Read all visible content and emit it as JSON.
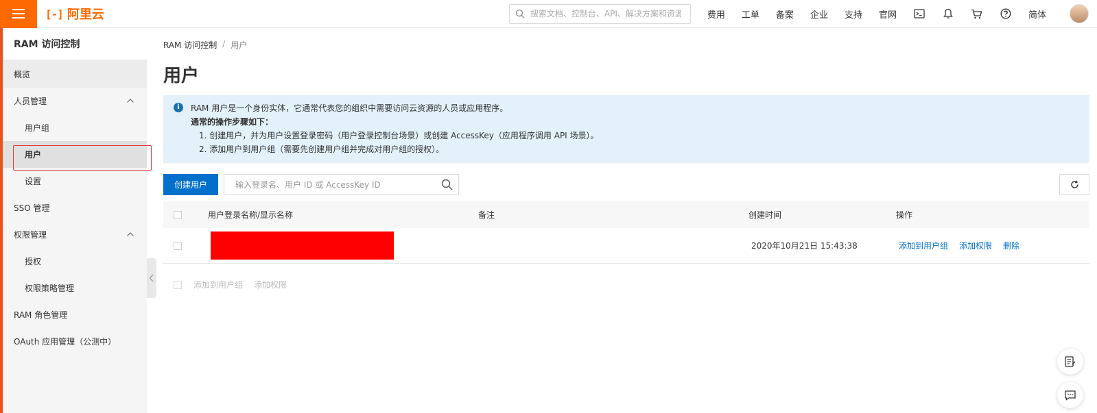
{
  "topbar": {
    "logo_text": "阿里云",
    "logo_mark": "[-]",
    "search_placeholder": "搜索文档、控制台、API、解决方案和资源",
    "nav_items": [
      "费用",
      "工单",
      "备案",
      "企业",
      "支持",
      "官网"
    ],
    "language": "简体",
    "brand_color": "#ff6a00"
  },
  "sidebar": {
    "title": "RAM 访问控制",
    "overview": "概览",
    "people_mgmt": "人员管理",
    "user_groups": "用户组",
    "users": "用户",
    "settings": "设置",
    "sso": "SSO 管理",
    "perm_mgmt": "权限管理",
    "grants": "授权",
    "policy_mgmt": "权限策略管理",
    "role_mgmt": "RAM 角色管理",
    "oauth": "OAuth 应用管理（公测中）"
  },
  "breadcrumb": {
    "root": "RAM 访问控制",
    "sep": "/",
    "current": "用户"
  },
  "page": {
    "title": "用户"
  },
  "info": {
    "icon": "i",
    "line1": "RAM 用户是一个身份实体，它通常代表您的组织中需要访问云资源的人员或应用程序。",
    "line2": "通常的操作步骤如下：",
    "step1": "1. 创建用户，并为用户设置登录密码（用户登录控制台场景）或创建 AccessKey（应用程序调用 API 场景）。",
    "step2": "2. 添加用户到用户组（需要先创建用户组并完成对用户组的授权）。"
  },
  "toolbar": {
    "create_user": "创建用户",
    "search_placeholder": "输入登录名、用户 ID 或 AccessKey ID",
    "primary_color": "#0070cc"
  },
  "table": {
    "headers": {
      "name": "用户登录名称/显示名称",
      "note": "备注",
      "created": "创建时间",
      "ops": "操作"
    },
    "rows": [
      {
        "created": "2020年10月21日 15:43:38",
        "op_add_group": "添加到用户组",
        "op_add_perm": "添加权限",
        "op_delete": "删除"
      }
    ]
  },
  "batch": {
    "add_group": "添加到用户组",
    "add_perm": "添加权限"
  }
}
